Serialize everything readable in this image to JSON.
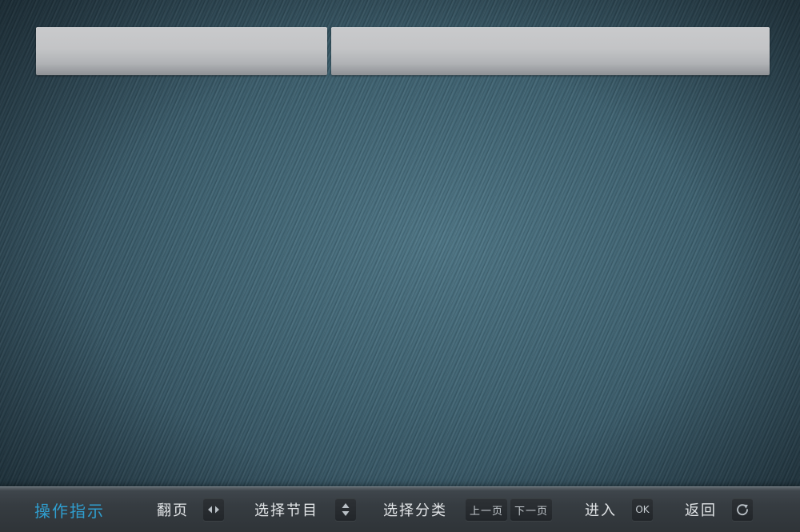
{
  "header": {
    "panels": [
      "",
      ""
    ]
  },
  "footer": {
    "title": "操作指示",
    "hints": {
      "page_turn": "翻页",
      "select_program": "选择节目",
      "select_category": "选择分类",
      "enter": "进入",
      "back": "返回"
    },
    "keys": {
      "prev_page": "上一页",
      "next_page": "下一页",
      "ok": "OK"
    },
    "icons": {
      "page_turn": "left-right-arrows-icon",
      "select_program": "up-down-arrows-icon",
      "back": "return-icon"
    }
  },
  "colors": {
    "title_accent": "#2f9fd0",
    "background": "#3e6271"
  }
}
